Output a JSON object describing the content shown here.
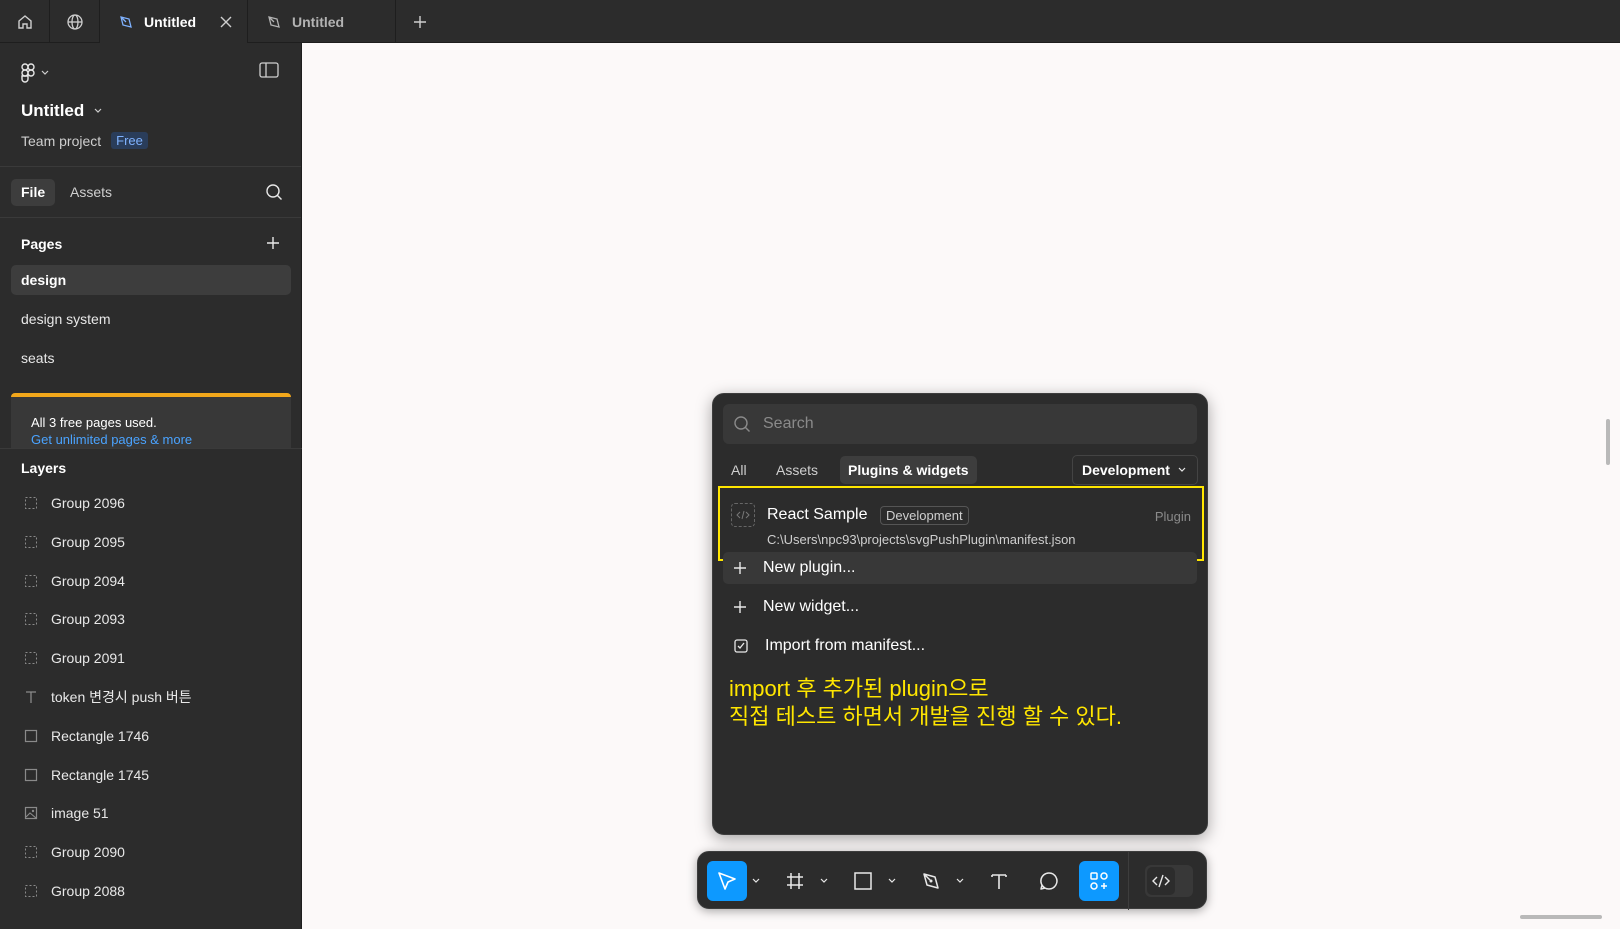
{
  "tabs": [
    {
      "title": "Untitled",
      "active": true
    },
    {
      "title": "Untitled",
      "active": false
    }
  ],
  "sidebar": {
    "file_name": "Untitled",
    "project": "Team project",
    "plan_badge": "Free",
    "tab_file": "File",
    "tab_assets": "Assets",
    "pages_heading": "Pages",
    "pages": [
      {
        "name": "design",
        "selected": true
      },
      {
        "name": "design system",
        "selected": false
      },
      {
        "name": "seats",
        "selected": false
      }
    ],
    "upsell_text": "All 3 free pages used.",
    "upsell_link": "Get unlimited pages & more",
    "layers_heading": "Layers",
    "layers": [
      {
        "name": "Group 2096",
        "icon": "group-icon"
      },
      {
        "name": "Group 2095",
        "icon": "group-icon"
      },
      {
        "name": "Group 2094",
        "icon": "group-icon"
      },
      {
        "name": "Group 2093",
        "icon": "group-icon"
      },
      {
        "name": "Group 2091",
        "icon": "group-icon"
      },
      {
        "name": "token 변경시 push 버튼",
        "icon": "text-icon"
      },
      {
        "name": "Rectangle 1746",
        "icon": "rectangle-icon"
      },
      {
        "name": "Rectangle 1745",
        "icon": "rectangle-icon"
      },
      {
        "name": "image 51",
        "icon": "image-icon"
      },
      {
        "name": "Group 2090",
        "icon": "group-icon"
      },
      {
        "name": "Group 2088",
        "icon": "group-icon"
      }
    ]
  },
  "popup": {
    "search_placeholder": "Search",
    "tabs": [
      "All",
      "Assets",
      "Plugins & widgets"
    ],
    "active_tab": "Plugins & widgets",
    "filter_dropdown": "Development",
    "result": {
      "name": "React Sample",
      "tag": "Development",
      "type": "Plugin",
      "path": "C:\\Users\\npc93\\projects\\svgPushPlugin\\manifest.json"
    },
    "actions": [
      "New plugin...",
      "New widget...",
      "Import from manifest..."
    ],
    "annotation_line1": "import 후 추가된 plugin으로",
    "annotation_line2": "직접 테스트 하면서 개발을 진행 할 수 있다.",
    "highlight_color": "#ffe600"
  },
  "toolbar": {
    "tools": [
      "move-tool",
      "frame-tool",
      "rectangle-tool",
      "pen-tool",
      "text-tool",
      "comment-tool",
      "actions-tool"
    ],
    "active_tools": [
      "move-tool",
      "actions-tool"
    ],
    "accent_color": "#0d99ff"
  }
}
